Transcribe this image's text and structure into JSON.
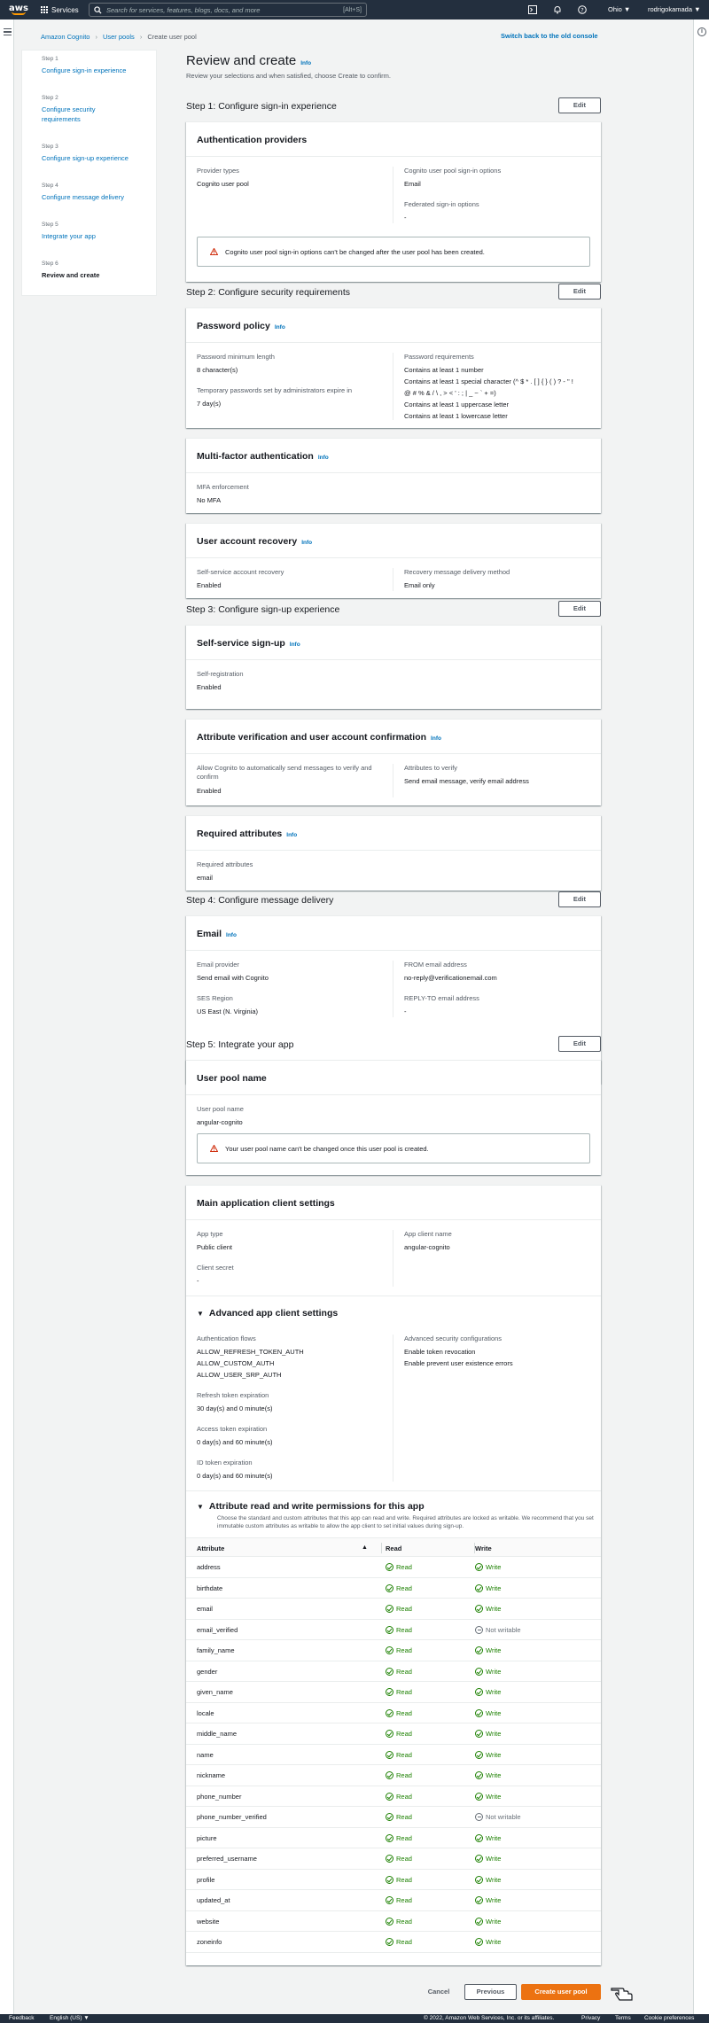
{
  "nav": {
    "logo_text": "aws",
    "services_label": "Services",
    "search_placeholder": "Search for services, features, blogs, docs, and more",
    "search_shortcut": "[Alt+S]",
    "region": "Ohio ▼",
    "account": "rodrigokamada ▼"
  },
  "breadcrumb": [
    "Amazon Cognito",
    "User pools",
    "Create user pool"
  ],
  "switch_console": "Switch back to the old console",
  "wizard": [
    {
      "num": "Step 1",
      "label": "Configure sign-in experience"
    },
    {
      "num": "Step 2",
      "label": "Configure security requirements"
    },
    {
      "num": "Step 3",
      "label": "Configure sign-up experience"
    },
    {
      "num": "Step 4",
      "label": "Configure message delivery"
    },
    {
      "num": "Step 5",
      "label": "Integrate your app"
    },
    {
      "num": "Step 6",
      "label": "Review and create"
    }
  ],
  "page": {
    "title": "Review and create",
    "info": "Info",
    "subtitle": "Review your selections and when satisfied, choose Create to confirm."
  },
  "edit_label": "Edit",
  "step1": {
    "title": "Step 1: Configure sign-in experience",
    "card_title": "Authentication providers",
    "provider_types_k": "Provider types",
    "provider_types_v": "Cognito user pool",
    "signin_k": "Cognito user pool sign-in options",
    "signin_v": "Email",
    "federated_k": "Federated sign-in options",
    "federated_v": "-",
    "warning": "Cognito user pool sign-in options can't be changed after the user pool has been created."
  },
  "step2": {
    "title": "Step 2: Configure security requirements",
    "pw_title": "Password policy",
    "pw_min_k": "Password minimum length",
    "pw_min_v": "8 character(s)",
    "temp_k": "Temporary passwords set by administrators expire in",
    "temp_v": "7 day(s)",
    "req_k": "Password requirements",
    "req_v": [
      "Contains at least 1 number",
      "Contains at least 1 special character (^ $ * . [ ] { } ( ) ? - \" !",
      "@ # % & / \\ , > < ' : ; | _ ~ ` + =)",
      "Contains at least 1 uppercase letter",
      "Contains at least 1 lowercase letter"
    ],
    "mfa_title": "Multi-factor authentication",
    "mfa_k": "MFA enforcement",
    "mfa_v": "No MFA",
    "rec_title": "User account recovery",
    "rec_k": "Self-service account recovery",
    "rec_v": "Enabled",
    "rec_method_k": "Recovery message delivery method",
    "rec_method_v": "Email only"
  },
  "step3": {
    "title": "Step 3: Configure sign-up experience",
    "ss_title": "Self-service sign-up",
    "ss_k": "Self-registration",
    "ss_v": "Enabled",
    "av_title": "Attribute verification and user account confirmation",
    "av_allow_k": "Allow Cognito to automatically send messages to verify and confirm",
    "av_allow_v": "Enabled",
    "av_attr_k": "Attributes to verify",
    "av_attr_v": "Send email message, verify email address",
    "ra_title": "Required attributes",
    "ra_k": "Required attributes",
    "ra_v": "email"
  },
  "step4": {
    "title": "Step 4: Configure message delivery",
    "card_title": "Email",
    "provider_k": "Email provider",
    "provider_v": "Send email with Cognito",
    "region_k": "SES Region",
    "region_v": "US East (N. Virginia)",
    "from_k": "FROM email address",
    "from_v": "no-reply@verificationemail.com",
    "reply_k": "REPLY-TO email address",
    "reply_v": "-"
  },
  "step5": {
    "title": "Step 5: Integrate your app",
    "upn_title": "User pool name",
    "upn_k": "User pool name",
    "upn_v": "angular-cognito",
    "upn_warning": "Your user pool name can't be changed once this user pool is created.",
    "main_title": "Main application client settings",
    "apptype_k": "App type",
    "apptype_v": "Public client",
    "appname_k": "App client name",
    "appname_v": "angular-cognito",
    "secret_k": "Client secret",
    "secret_v": "-",
    "adv_title": "Advanced app client settings",
    "flows_k": "Authentication flows",
    "flows_v": [
      "ALLOW_REFRESH_TOKEN_AUTH",
      "ALLOW_CUSTOM_AUTH",
      "ALLOW_USER_SRP_AUTH"
    ],
    "refresh_k": "Refresh token expiration",
    "refresh_v": "30 day(s) and 0 minute(s)",
    "access_k": "Access token expiration",
    "access_v": "0 day(s) and 60 minute(s)",
    "id_k": "ID token expiration",
    "id_v": "0 day(s) and 60 minute(s)",
    "sec_k": "Advanced security configurations",
    "sec_v": [
      "Enable token revocation",
      "Enable prevent user existence errors"
    ],
    "perm_title": "Attribute read and write permissions for this app",
    "perm_desc": "Choose the standard and custom attributes that this app can read and write. Required attributes are locked as writable. We recommend that you set immutable custom attributes as writable to allow the app client to set initial values during sign-up.",
    "col_attr": "Attribute",
    "col_read": "Read",
    "col_write": "Write",
    "sort_icon": "▲"
  },
  "attributes": [
    {
      "name": "address",
      "read": "Read",
      "write": "Write",
      "writable": true
    },
    {
      "name": "birthdate",
      "read": "Read",
      "write": "Write",
      "writable": true
    },
    {
      "name": "email",
      "read": "Read",
      "write": "Write",
      "writable": true
    },
    {
      "name": "email_verified",
      "read": "Read",
      "write": "Not writable",
      "writable": false
    },
    {
      "name": "family_name",
      "read": "Read",
      "write": "Write",
      "writable": true
    },
    {
      "name": "gender",
      "read": "Read",
      "write": "Write",
      "writable": true
    },
    {
      "name": "given_name",
      "read": "Read",
      "write": "Write",
      "writable": true
    },
    {
      "name": "locale",
      "read": "Read",
      "write": "Write",
      "writable": true
    },
    {
      "name": "middle_name",
      "read": "Read",
      "write": "Write",
      "writable": true
    },
    {
      "name": "name",
      "read": "Read",
      "write": "Write",
      "writable": true
    },
    {
      "name": "nickname",
      "read": "Read",
      "write": "Write",
      "writable": true
    },
    {
      "name": "phone_number",
      "read": "Read",
      "write": "Write",
      "writable": true
    },
    {
      "name": "phone_number_verified",
      "read": "Read",
      "write": "Not writable",
      "writable": false
    },
    {
      "name": "picture",
      "read": "Read",
      "write": "Write",
      "writable": true
    },
    {
      "name": "preferred_username",
      "read": "Read",
      "write": "Write",
      "writable": true
    },
    {
      "name": "profile",
      "read": "Read",
      "write": "Write",
      "writable": true
    },
    {
      "name": "updated_at",
      "read": "Read",
      "write": "Write",
      "writable": true
    },
    {
      "name": "website",
      "read": "Read",
      "write": "Write",
      "writable": true
    },
    {
      "name": "zoneinfo",
      "read": "Read",
      "write": "Write",
      "writable": true
    }
  ],
  "actions": {
    "cancel": "Cancel",
    "previous": "Previous",
    "create": "Create user pool"
  },
  "footer": {
    "feedback": "Feedback",
    "language": "English (US) ▼",
    "copyright": "© 2022, Amazon Web Services, Inc. or its affiliates.",
    "privacy": "Privacy",
    "terms": "Terms",
    "cookies": "Cookie preferences"
  },
  "colors": {
    "accent": "#0073bb",
    "primary_button": "#ec7211",
    "success": "#1d8102",
    "nav_bg": "#232f3e"
  }
}
